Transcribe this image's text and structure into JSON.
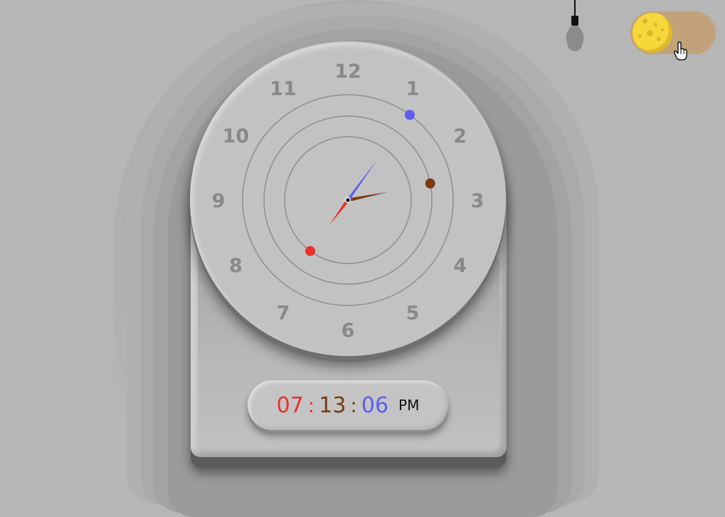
{
  "clock": {
    "numerals": [
      "12",
      "1",
      "2",
      "3",
      "4",
      "5",
      "6",
      "7",
      "8",
      "9",
      "10",
      "11"
    ],
    "time": {
      "hours": "07",
      "minutes": "13",
      "seconds": "06",
      "period": "PM"
    },
    "separator": ":"
  },
  "colors": {
    "hours": "#e8302f",
    "minutes": "#7a3a12",
    "seconds": "#5a5cf3",
    "background": "#b6b6b6",
    "toggle_track": "#c2a27a",
    "moon": "#f6d83a"
  },
  "theme_toggle": {
    "state": "light",
    "icon": "moon-icon"
  },
  "lamp": {
    "icon": "light-bulb-icon"
  }
}
